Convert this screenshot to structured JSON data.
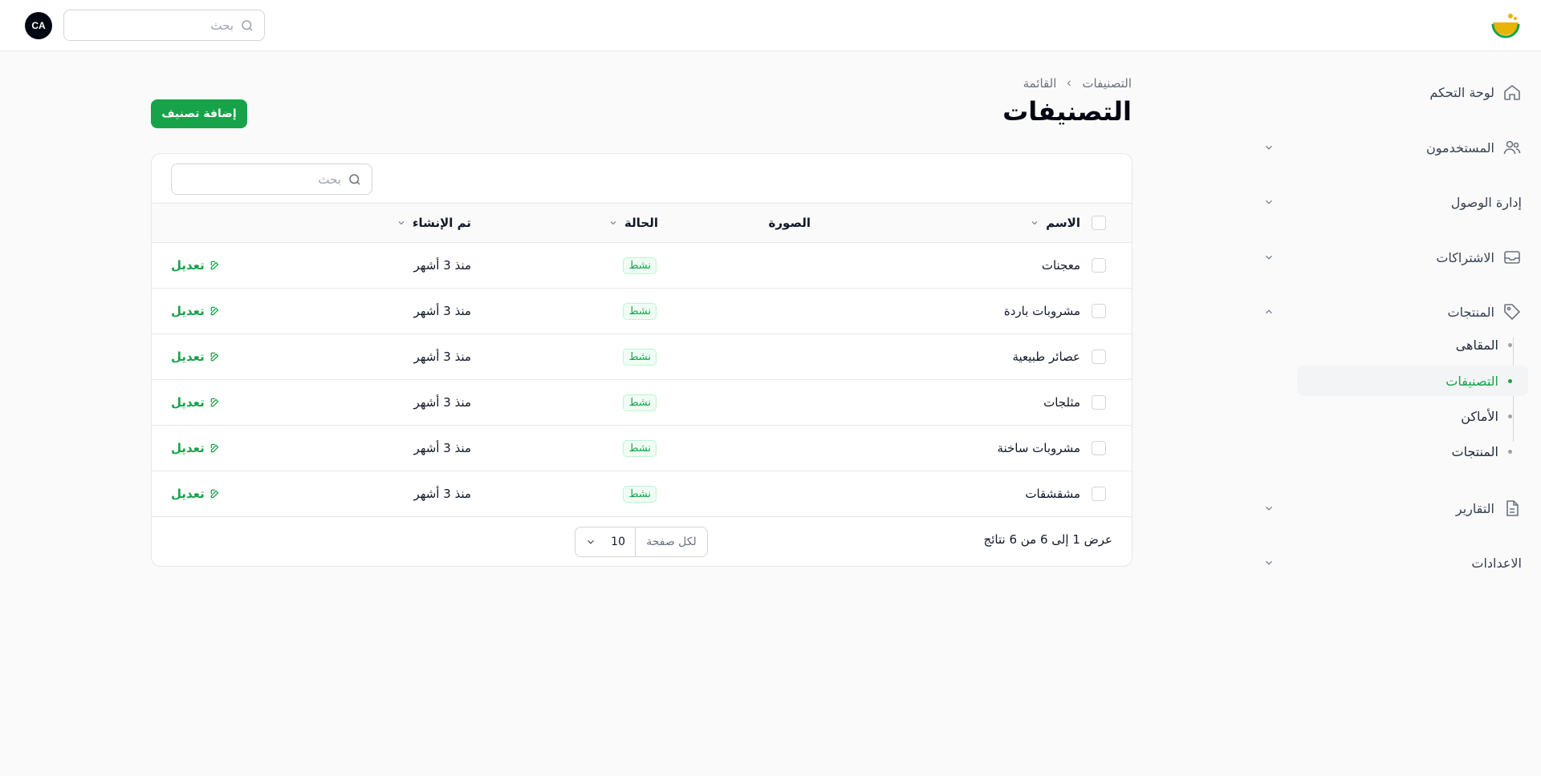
{
  "topbar": {
    "search_placeholder": "بحث",
    "avatar_initials": "CA"
  },
  "sidebar": {
    "items": [
      {
        "label": "لوحة التحكم",
        "icon": "home-icon"
      },
      {
        "label": "المستخدمون",
        "icon": "users-icon",
        "expandable": true
      },
      {
        "label": "إدارة الوصول",
        "icon": "",
        "expandable": true
      },
      {
        "label": "الاشتراكات",
        "icon": "inbox-icon",
        "expandable": true
      },
      {
        "label": "المنتجات",
        "icon": "tag-icon",
        "expanded": true,
        "children": [
          {
            "label": "المقاهى"
          },
          {
            "label": "التصنيفات",
            "active": true
          },
          {
            "label": "الأماكن"
          },
          {
            "label": "المنتجات"
          }
        ]
      },
      {
        "label": "التقارير",
        "icon": "document-icon",
        "expandable": true
      },
      {
        "label": "الاعدادات",
        "icon": "",
        "expandable": true
      }
    ]
  },
  "breadcrumb": [
    "التصنيفات",
    "القائمة"
  ],
  "page_title": "التصنيفات",
  "add_button": "إضافة تصنيف",
  "table": {
    "search_placeholder": "بحث",
    "columns": {
      "name": "الاسم",
      "image": "الصورة",
      "status": "الحالة",
      "created": "تم الإنشاء"
    },
    "rows": [
      {
        "name": "معجنات",
        "status": "نشط",
        "created": "منذ 3 أشهر",
        "action": "تعديل"
      },
      {
        "name": "مشروبات باردة",
        "status": "نشط",
        "created": "منذ 3 أشهر",
        "action": "تعديل"
      },
      {
        "name": "عصائر طبيعية",
        "status": "نشط",
        "created": "منذ 3 أشهر",
        "action": "تعديل"
      },
      {
        "name": "مثلجات",
        "status": "نشط",
        "created": "منذ 3 أشهر",
        "action": "تعديل"
      },
      {
        "name": "مشروبات ساخنة",
        "status": "نشط",
        "created": "منذ 3 أشهر",
        "action": "تعديل"
      },
      {
        "name": "مشقشقات",
        "status": "نشط",
        "created": "منذ 3 أشهر",
        "action": "تعديل"
      }
    ],
    "summary": "عرض 1 إلى 6 من 6 نتائج",
    "per_page_label": "لكل صفحة",
    "per_page_value": "10"
  },
  "colors": {
    "accent": "#16a34a",
    "badge_bg": "#f0fdf4",
    "border": "#e5e7eb"
  }
}
